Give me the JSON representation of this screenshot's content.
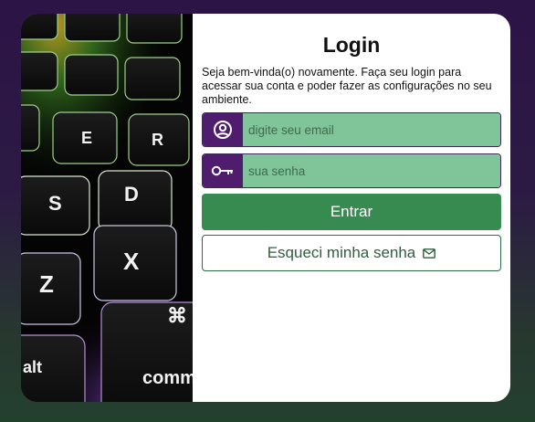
{
  "login": {
    "title": "Login",
    "description": "Seja bem-vinda(o) novamente. Faça seu login para acessar sua conta e poder fazer as configurações no seu ambiente.",
    "email_placeholder": "digite seu email",
    "password_placeholder": "sua senha",
    "submit_label": "Entrar",
    "forgot_label": "Esqueci minha senha"
  },
  "keyboard_photo": {
    "keys": [
      "E",
      "R",
      "S",
      "D",
      "Z",
      "X",
      "⌘",
      "alt",
      "comma"
    ]
  },
  "icons": {
    "email_field": "user-circle-icon",
    "password_field": "key-icon",
    "forgot_button": "envelope-icon"
  },
  "colors": {
    "accent_purple": "#4f1c6e",
    "input_green": "#7fc599",
    "button_green": "#378a50"
  }
}
